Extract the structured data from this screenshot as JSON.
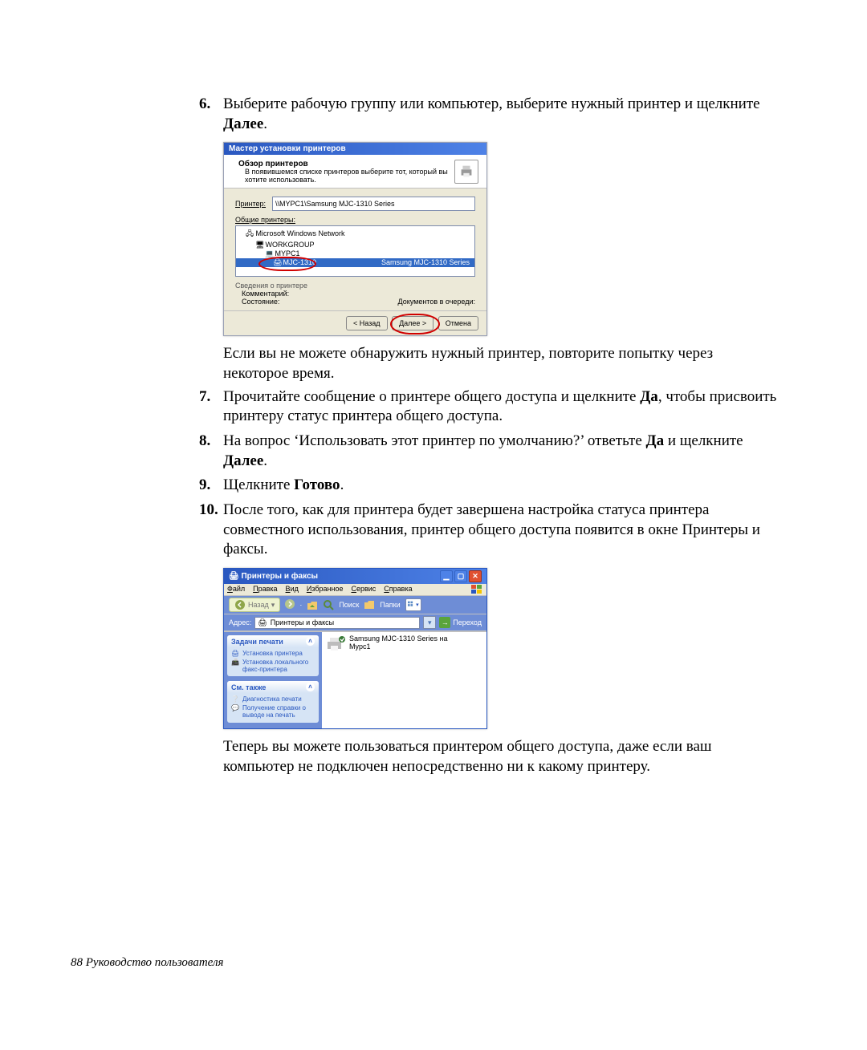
{
  "steps": {
    "6": "Выберите рабочую группу или компьютер, выберите нужный принтер и щелкните",
    "6_bold": "Далее",
    "after6_1": "Если вы не можете обнаружить нужный принтер, повторите попытку через некоторое время.",
    "7": "Прочитайте сообщение о принтере общего доступа и щелкните",
    "7_bold": "Да",
    "7_tail": ", чтобы присвоить принтеру статус принтера общего доступа.",
    "8": "На вопрос ‘Использовать этот принтер по умолчанию?’ ответьте",
    "8_bold": "Да",
    "8_mid": " и щелкните ",
    "8_bold2": "Далее",
    "9": "Щелкните",
    "9_bold": "Готово",
    "10": "После того, как для принтера будет завершена настройка статуса принтера совместного использования, принтер общего доступа появится в окне Принтеры и факсы.",
    "after10": "Теперь вы можете пользоваться принтером общего доступа, даже если ваш компьютер не подключен непосредственно ни к какому принтеру."
  },
  "footer": "88  Руководство пользователя",
  "wizard": {
    "title": "Мастер установки принтеров",
    "header_title": "Обзор принтеров",
    "header_sub": "В появившемся списке принтеров выберите тот, который вы хотите использовать.",
    "printer_label": "Принтер:",
    "printer_value": "\\\\MYPC1\\Samsung MJC-1310 Series",
    "shared_label": "Общие принтеры:",
    "tree": {
      "n1": "Microsoft Windows Network",
      "n2": "WORKGROUP",
      "n3": "MYPC1",
      "n4_name": "MJC-1310",
      "n4_right": "Samsung MJC-1310 Series"
    },
    "info_title": "Сведения о принтере",
    "info_comment_label": "Комментарий:",
    "info_status_label": "Состояние:",
    "info_docs_label": "Документов в очереди:",
    "btn_back": "< Назад",
    "btn_next": "Далее >",
    "btn_cancel": "Отмена"
  },
  "pf": {
    "title": "Принтеры и факсы",
    "menu": {
      "file": "Файл",
      "edit": "Правка",
      "view": "Вид",
      "fav": "Избранное",
      "tools": "Сервис",
      "help": "Справка"
    },
    "tb": {
      "back": "Назад",
      "search": "Поиск",
      "folders": "Папки"
    },
    "addr_label": "Адрес:",
    "addr_value": "Принтеры и факсы",
    "goto": "Переход",
    "panel1": {
      "title": "Задачи печати",
      "link1": "Установка принтера",
      "link2": "Установка локального факс-принтера"
    },
    "panel2": {
      "title": "См. также",
      "link1": "Диагностика печати",
      "link2": "Получение справки о выводе на печать"
    },
    "printer": {
      "line1": "Samsung MJC-1310 Series на",
      "line2": "Mypc1"
    }
  }
}
